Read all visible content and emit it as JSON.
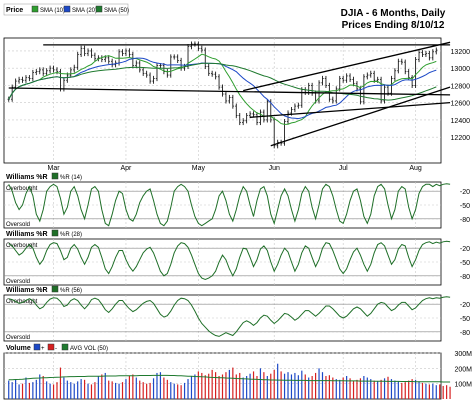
{
  "title": {
    "line1": "DJIA - 6 Months, Daily",
    "line2": "Prices Ending 8/10/12"
  },
  "colors": {
    "price_bar": "#1a1a1a",
    "sma10": "#2e9e2e",
    "sma20": "#1d49c7",
    "sma50": "#1f7a2f",
    "trendline": "#000000",
    "williams": "#1f6f28",
    "avg_vol": "#1f7a2f",
    "vol_up": "#1d49c7",
    "vol_down": "#d62020",
    "grid": "#c8c8c8",
    "frame": "#000000",
    "panel_bg": "#ffffff"
  },
  "chart_data": [
    {
      "type": "line",
      "panel": "price",
      "legend_label": "Price",
      "legend": [
        "SMA (10)",
        "SMA (20)",
        "SMA (50)"
      ],
      "ylim": [
        11900,
        13350
      ],
      "y_ticks": [
        12200,
        12400,
        12600,
        12800,
        13000,
        13200
      ],
      "y_tick_labels": [
        "12200",
        "12400",
        "12600",
        "12800",
        "13000",
        "13200"
      ],
      "x_labels": [
        "Mar",
        "Apr",
        "May",
        "Jun",
        "Jul",
        "Aug"
      ],
      "x_label_index": [
        13,
        34,
        55,
        77,
        97,
        118
      ],
      "grid": true,
      "close": [
        12640,
        12780,
        12850,
        12870,
        12860,
        12890,
        12880,
        12950,
        12960,
        12980,
        12940,
        12970,
        13000,
        12980,
        12960,
        12760,
        12860,
        12920,
        12980,
        13010,
        13160,
        13230,
        13170,
        13200,
        13150,
        13110,
        13120,
        13100,
        13120,
        13080,
        13040,
        13060,
        13190,
        13170,
        13200,
        13160,
        13030,
        13060,
        12980,
        12940,
        12920,
        12850,
        12880,
        13030,
        13030,
        12960,
        12920,
        13130,
        13130,
        13090,
        13000,
        13020,
        13250,
        13280,
        13280,
        13230,
        13210,
        13020,
        12940,
        12930,
        12900,
        12780,
        12700,
        12620,
        12660,
        12560,
        12450,
        12370,
        12390,
        12450,
        12470,
        12460,
        12370,
        12490,
        12400,
        12610,
        12400,
        12100,
        12140,
        12130,
        12380,
        12480,
        12520,
        12560,
        12570,
        12750,
        12720,
        12800,
        12710,
        12620,
        12830,
        12880,
        12800,
        12640,
        12620,
        12760,
        12880,
        12860,
        12910,
        12870,
        12820,
        12760,
        12610,
        12900,
        12920,
        12940,
        12860,
        12870,
        12620,
        12780,
        12710,
        12880,
        12970,
        13080,
        13070,
        12960,
        12890,
        12800,
        13100,
        13180,
        13160,
        13170,
        13120,
        13190,
        13210
      ],
      "sma10_range": [
        12720,
        13190
      ],
      "sma20_range": [
        12560,
        13150
      ],
      "sma50_range": [
        12680,
        13080
      ],
      "trendlines": [
        {
          "from": [
            10,
            13270
          ],
          "to": [
            128,
            13270
          ]
        },
        {
          "from": [
            0,
            12770
          ],
          "to": [
            128,
            12690
          ]
        },
        {
          "from": [
            68,
            12740
          ],
          "to": [
            128,
            13300
          ]
        },
        {
          "from": [
            70,
            12430
          ],
          "to": [
            128,
            12600
          ]
        },
        {
          "from": [
            76,
            12100
          ],
          "to": [
            128,
            12780
          ]
        }
      ]
    },
    {
      "type": "line",
      "panel": "williams-14",
      "legend_label": "Williams %R",
      "legend": [
        "%R (14)"
      ],
      "ylim": [
        -100,
        0
      ],
      "y_ticks": [
        -20,
        -50,
        -80
      ],
      "y_tick_labels": [
        "-20",
        "-50",
        "-80"
      ],
      "zone_labels": [
        "Overbought",
        "Oversold"
      ],
      "values": [
        -5,
        -20,
        -45,
        -60,
        -50,
        -25,
        -10,
        -30,
        -70,
        -85,
        -60,
        -20,
        -10,
        -5,
        -10,
        -35,
        -70,
        -55,
        -20,
        -10,
        -30,
        -60,
        -80,
        -50,
        -15,
        -10,
        -20,
        -60,
        -90,
        -95,
        -70,
        -40,
        -20,
        -25,
        -60,
        -80,
        -85,
        -70,
        -45,
        -30,
        -20,
        -15,
        -40,
        -70,
        -90,
        -95,
        -85,
        -55,
        -20,
        -10,
        -5,
        -10,
        -20,
        -50,
        -75,
        -90,
        -95,
        -90,
        -85,
        -80,
        -60,
        -30,
        -20,
        -40,
        -70,
        -85,
        -60,
        -30,
        -10,
        -20,
        -50,
        -75,
        -40,
        -15,
        -10,
        -30,
        -70,
        -90,
        -60,
        -30,
        -15,
        -30,
        -60,
        -85,
        -60,
        -25,
        -10,
        -20,
        -55,
        -80,
        -50,
        -15,
        -5,
        -10,
        -30,
        -60,
        -85,
        -90,
        -70,
        -40,
        -20,
        -15,
        -40,
        -75,
        -90,
        -70,
        -30,
        -10,
        -5,
        -15,
        -50,
        -80,
        -60,
        -20,
        -10,
        -15,
        -55,
        -80,
        -60,
        -25,
        -10,
        -5,
        -5,
        -10,
        -5,
        -8,
        -5,
        -4,
        -5
      ]
    },
    {
      "type": "line",
      "panel": "williams-28",
      "legend_label": "Williams %R",
      "legend": [
        "%R (28)"
      ],
      "ylim": [
        -100,
        0
      ],
      "y_ticks": [
        -20,
        -50,
        -80
      ],
      "y_tick_labels": [
        "-20",
        "-50",
        "-80"
      ],
      "zone_labels": [
        "Overbought",
        "Oversold"
      ],
      "values": [
        -10,
        -15,
        -25,
        -35,
        -30,
        -20,
        -12,
        -20,
        -40,
        -55,
        -45,
        -25,
        -12,
        -8,
        -10,
        -25,
        -45,
        -40,
        -20,
        -12,
        -22,
        -40,
        -55,
        -40,
        -18,
        -12,
        -18,
        -40,
        -65,
        -75,
        -60,
        -40,
        -25,
        -25,
        -45,
        -60,
        -70,
        -60,
        -45,
        -30,
        -22,
        -18,
        -30,
        -50,
        -70,
        -80,
        -75,
        -55,
        -30,
        -15,
        -8,
        -10,
        -18,
        -35,
        -55,
        -75,
        -85,
        -88,
        -85,
        -80,
        -70,
        -50,
        -35,
        -45,
        -65,
        -80,
        -65,
        -40,
        -20,
        -22,
        -40,
        -60,
        -45,
        -22,
        -15,
        -25,
        -50,
        -70,
        -55,
        -35,
        -20,
        -28,
        -50,
        -70,
        -55,
        -30,
        -15,
        -20,
        -40,
        -60,
        -45,
        -20,
        -8,
        -10,
        -25,
        -45,
        -65,
        -75,
        -65,
        -45,
        -28,
        -20,
        -35,
        -55,
        -70,
        -55,
        -30,
        -12,
        -8,
        -15,
        -35,
        -55,
        -45,
        -22,
        -12,
        -15,
        -40,
        -60,
        -45,
        -25,
        -12,
        -8,
        -6,
        -10,
        -7,
        -9,
        -6,
        -5,
        -6
      ]
    },
    {
      "type": "line",
      "panel": "williams-56",
      "legend_label": "Williams %R",
      "legend": [
        "%R (56)"
      ],
      "ylim": [
        -100,
        0
      ],
      "y_ticks": [
        -20,
        -50,
        -80
      ],
      "y_tick_labels": [
        "-20",
        "-50",
        "-80"
      ],
      "zone_labels": [
        "Overbought",
        "Oversold"
      ],
      "values": [
        -8,
        -10,
        -14,
        -18,
        -16,
        -12,
        -8,
        -12,
        -22,
        -30,
        -26,
        -16,
        -9,
        -6,
        -7,
        -14,
        -25,
        -22,
        -12,
        -8,
        -12,
        -22,
        -30,
        -22,
        -10,
        -7,
        -10,
        -20,
        -32,
        -38,
        -30,
        -20,
        -12,
        -12,
        -22,
        -30,
        -36,
        -32,
        -25,
        -18,
        -14,
        -12,
        -18,
        -30,
        -42,
        -48,
        -45,
        -35,
        -22,
        -12,
        -7,
        -8,
        -12,
        -22,
        -35,
        -50,
        -62,
        -70,
        -78,
        -84,
        -88,
        -90,
        -86,
        -82,
        -85,
        -88,
        -80,
        -70,
        -60,
        -56,
        -60,
        -66,
        -60,
        -50,
        -44,
        -46,
        -55,
        -62,
        -56,
        -48,
        -40,
        -42,
        -48,
        -55,
        -50,
        -42,
        -34,
        -34,
        -40,
        -46,
        -40,
        -32,
        -24,
        -24,
        -30,
        -38,
        -46,
        -50,
        -46,
        -38,
        -30,
        -26,
        -30,
        -38,
        -46,
        -40,
        -30,
        -20,
        -16,
        -18,
        -26,
        -34,
        -30,
        -22,
        -16,
        -16,
        -24,
        -32,
        -28,
        -20,
        -12,
        -8,
        -6,
        -8,
        -6,
        -7,
        -5,
        -4,
        -5
      ]
    },
    {
      "type": "bar",
      "panel": "volume",
      "legend_label": "Volume",
      "legend": [
        "+",
        "-",
        "AVG VOL (50)"
      ],
      "ylim": [
        0,
        300
      ],
      "y_ticks": [
        100,
        200,
        300
      ],
      "y_tick_labels": [
        "100M",
        "200M",
        "300M"
      ],
      "values": [
        120,
        110,
        130,
        95,
        100,
        140,
        105,
        110,
        125,
        160,
        150,
        115,
        100,
        95,
        110,
        205,
        140,
        120,
        110,
        100,
        115,
        130,
        125,
        100,
        95,
        110,
        150,
        160,
        170,
        120,
        115,
        105,
        100,
        110,
        130,
        150,
        160,
        140,
        120,
        110,
        100,
        105,
        135,
        170,
        175,
        140,
        125,
        110,
        100,
        95,
        90,
        105,
        130,
        150,
        160,
        180,
        170,
        155,
        165,
        190,
        175,
        150,
        160,
        175,
        190,
        205,
        160,
        170,
        140,
        150,
        165,
        180,
        150,
        200,
        175,
        150,
        165,
        190,
        230,
        180,
        165,
        175,
        160,
        170,
        155,
        185,
        160,
        140,
        150,
        170,
        200,
        175,
        150,
        155,
        140,
        130,
        125,
        140,
        150,
        135,
        120,
        125,
        135,
        150,
        140,
        130,
        120,
        115,
        125,
        135,
        145,
        130,
        120,
        115,
        105,
        110,
        120,
        130,
        125,
        115,
        105,
        100,
        95,
        100,
        90,
        95,
        85,
        90,
        80
      ],
      "avg_vol": [
        125,
        126,
        127,
        128,
        129,
        131,
        133,
        135,
        136,
        137,
        138,
        139,
        140,
        141,
        142,
        143,
        144,
        145,
        146,
        146,
        147,
        147,
        147,
        148,
        148,
        148,
        149,
        149,
        150,
        150,
        150,
        150,
        151,
        151,
        151,
        152,
        152,
        152,
        153,
        153,
        153,
        153,
        154,
        154,
        154,
        154,
        154,
        153,
        153,
        152,
        151,
        150,
        149,
        148,
        147,
        146,
        145,
        144,
        142,
        141,
        140,
        139,
        138,
        137,
        136,
        135,
        134,
        133,
        132,
        131,
        130,
        129,
        128,
        127,
        126,
        125,
        124,
        124,
        123,
        123,
        122,
        122,
        122,
        121,
        121,
        121,
        121,
        120,
        120,
        120,
        120,
        120,
        120,
        120,
        119,
        119,
        119,
        119,
        118,
        118,
        118,
        118,
        117,
        117,
        117,
        117,
        116,
        116,
        116,
        116,
        115,
        115,
        115,
        115,
        114,
        114,
        114,
        114,
        113,
        113,
        113,
        113,
        112,
        112,
        112,
        112,
        111,
        111,
        111
      ]
    }
  ]
}
